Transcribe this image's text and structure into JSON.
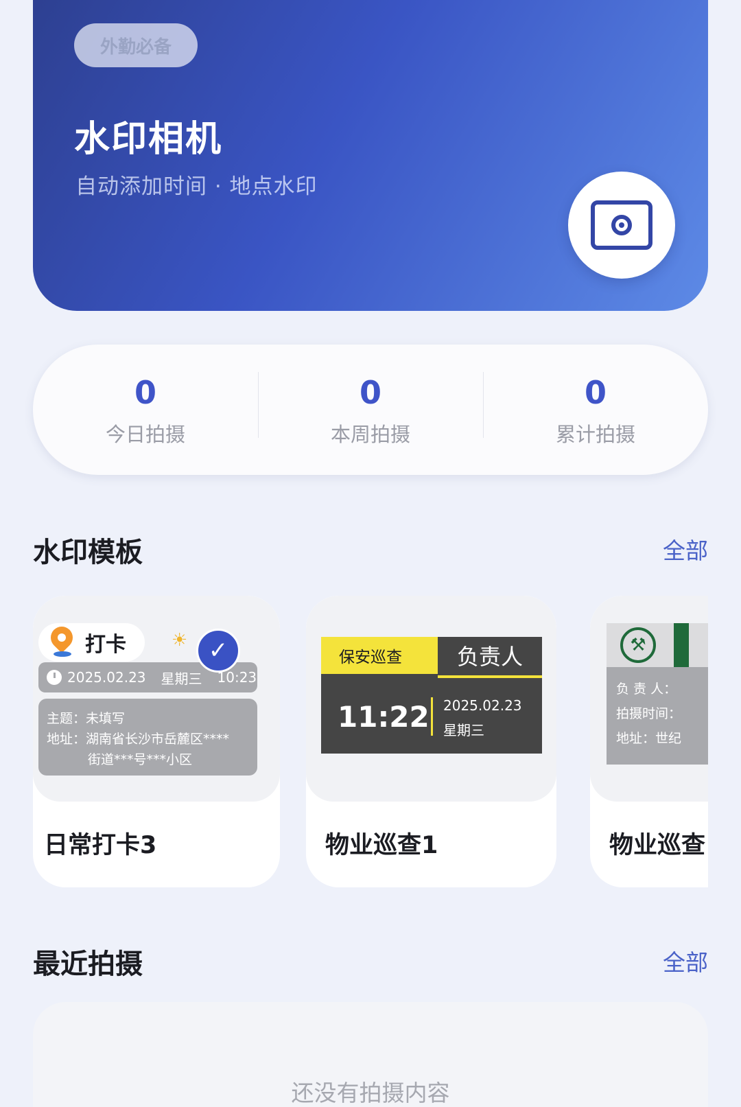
{
  "hero": {
    "badge": "外勤必备",
    "title": "水印相机",
    "subtitle": "自动添加时间 · 地点水印",
    "camera_icon": "camera-icon",
    "colors": {
      "gradient_start": "#2d3f8f",
      "gradient_end": "#5d8ae6"
    }
  },
  "stats": [
    {
      "value": "0",
      "label": "今日拍摄"
    },
    {
      "value": "0",
      "label": "本周拍摄"
    },
    {
      "value": "0",
      "label": "累计拍摄"
    }
  ],
  "templates_section": {
    "title": "水印模板",
    "more_label": "全部",
    "cards": [
      {
        "name": "日常打卡3",
        "selected": true,
        "preview": {
          "pill_text": "打卡",
          "date": "2025.02.23",
          "weekday": "星期三",
          "time": "10:23",
          "topic": "主题：未填写",
          "address_line1": "地址：湖南省长沙市岳麓区****",
          "address_line2": "街道***号***小区"
        }
      },
      {
        "name": "物业巡查1",
        "preview": {
          "tag": "保安巡查",
          "head": "负责人",
          "time": "11:22",
          "date": "2025.02.23",
          "weekday": "星期三"
        }
      },
      {
        "name": "物业巡查",
        "preview": {
          "line1": "负 责 人：",
          "line2": "拍摄时间：",
          "line3": "地址：世纪"
        }
      }
    ]
  },
  "recent_section": {
    "title": "最近拍摄",
    "more_label": "全部",
    "empty_text": "还没有拍摄内容"
  },
  "accent_color": "#3f54c8"
}
